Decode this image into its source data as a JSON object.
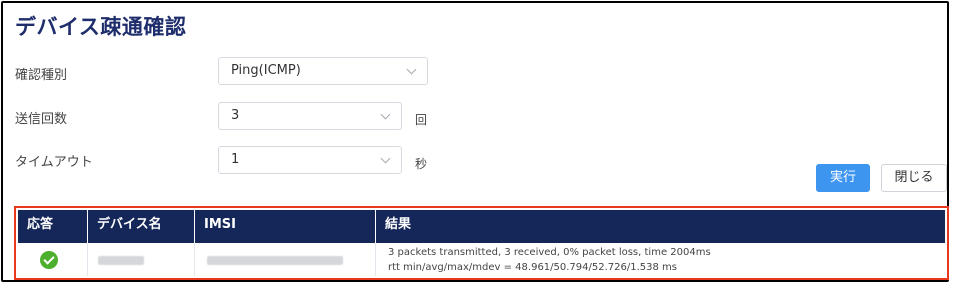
{
  "page": {
    "title": "デバイス疎通確認"
  },
  "form": {
    "check_type": {
      "label": "確認種別",
      "value": "Ping(ICMP)"
    },
    "send_count": {
      "label": "送信回数",
      "value": "3",
      "unit": "回"
    },
    "timeout": {
      "label": "タイムアウト",
      "value": "1",
      "unit": "秒"
    }
  },
  "actions": {
    "execute_label": "実行",
    "close_label": "閉じる"
  },
  "table": {
    "headers": {
      "response": "応答",
      "device_name": "デバイス名",
      "imsi": "IMSI",
      "result": "結果"
    },
    "rows": [
      {
        "response_icon": "success-check-icon",
        "device_name": "",
        "imsi": "",
        "result_line1": "3 packets transmitted, 3 received, 0% packet loss, time 2004ms",
        "result_line2": "rtt min/avg/max/mdev = 48.961/50.794/52.726/1.538 ms"
      }
    ]
  },
  "colors": {
    "title": "#1e2d6b",
    "table_header_bg": "#152659",
    "primary_button": "#3d95f0",
    "highlight_border": "#e8391f",
    "success": "#4caf2e"
  }
}
